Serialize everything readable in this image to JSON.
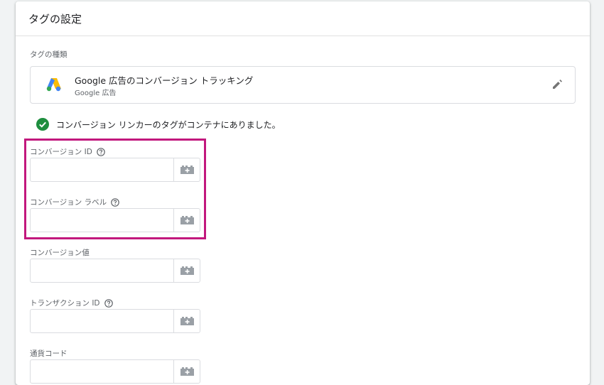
{
  "card": {
    "title": "タグの設定"
  },
  "tag_type": {
    "section_label": "タグの種類",
    "name": "Google 広告のコンバージョン トラッキング",
    "subtitle": "Google 広告",
    "icon": "google-ads-logo",
    "edit_icon": "pencil-icon"
  },
  "notice": {
    "icon": "check-circle-icon",
    "text": "コンバージョン リンカーのタグがコンテナにありました。"
  },
  "fields": [
    {
      "label": "コンバージョン ID",
      "value": "",
      "has_help": true
    },
    {
      "label": "コンバージョン ラベル",
      "value": "",
      "has_help": true
    },
    {
      "label": "コンバージョン値",
      "value": "",
      "has_help": false
    },
    {
      "label": "トランザクション ID",
      "value": "",
      "has_help": true
    },
    {
      "label": "通貨コード",
      "value": "",
      "has_help": false
    }
  ],
  "colors": {
    "highlight": "#c2187d",
    "success": "#1e8e3e",
    "ads_blue": "#4285f4",
    "ads_yellow": "#fbbc04",
    "ads_green": "#34a853"
  }
}
